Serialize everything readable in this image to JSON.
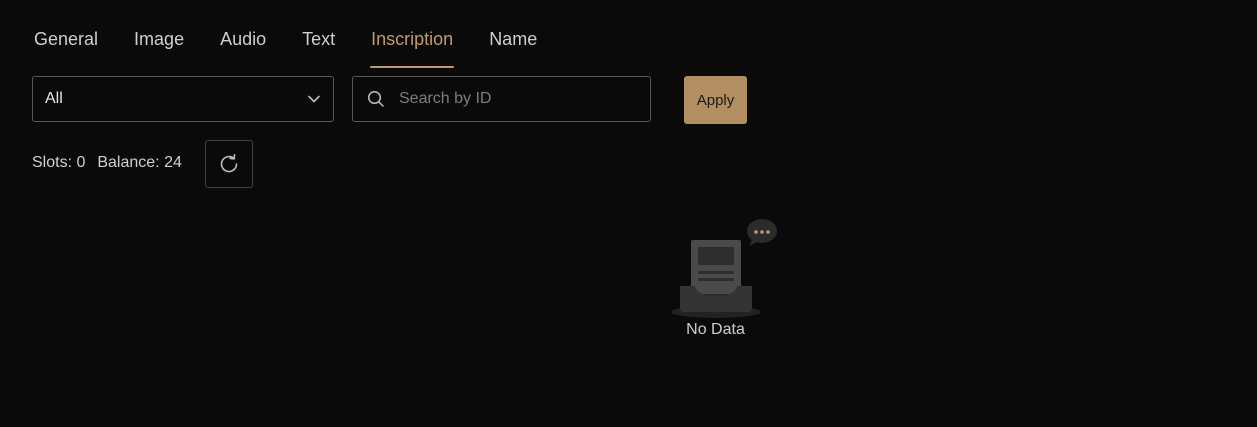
{
  "tabs": [
    {
      "label": "General",
      "active": false
    },
    {
      "label": "Image",
      "active": false
    },
    {
      "label": "Audio",
      "active": false
    },
    {
      "label": "Text",
      "active": false
    },
    {
      "label": "Inscription",
      "active": true
    },
    {
      "label": "Name",
      "active": false
    }
  ],
  "filter": {
    "selected": "All"
  },
  "search": {
    "placeholder": "Search by ID",
    "value": ""
  },
  "apply_label": "Apply",
  "stats": {
    "slots": "Slots: 0",
    "balance": "Balance: 24"
  },
  "empty_state": {
    "label": "No Data"
  },
  "colors": {
    "accent": "#c39a6b",
    "button": "#b48e63",
    "background": "#0a0a0a"
  },
  "icons": {
    "select": "chevron-down-icon",
    "search": "search-icon",
    "refresh": "refresh-icon",
    "empty": "empty-inbox-icon"
  }
}
